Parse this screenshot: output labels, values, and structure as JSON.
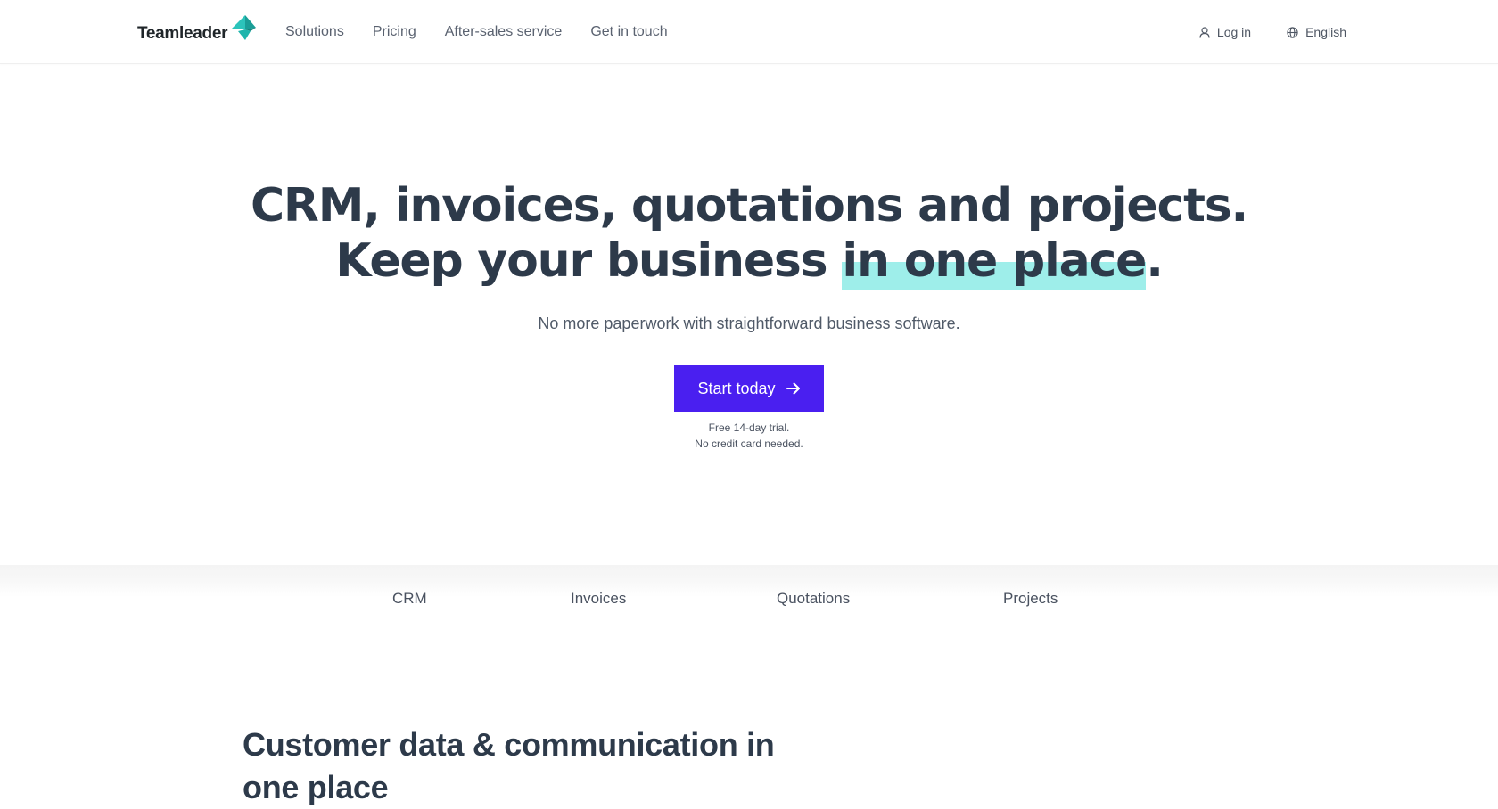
{
  "header": {
    "logo_text": "Teamleader",
    "nav": [
      {
        "label": "Solutions"
      },
      {
        "label": "Pricing"
      },
      {
        "label": "After-sales service"
      },
      {
        "label": "Get in touch"
      }
    ],
    "login": {
      "label": "Log in",
      "icon": "user-icon"
    },
    "language": {
      "label": "English",
      "icon": "globe-icon"
    }
  },
  "hero": {
    "title_line1": "CRM, invoices, quotations and projects.",
    "title_line2_prefix": "Keep your business ",
    "title_line2_highlight": "in one place",
    "title_line2_suffix": ".",
    "subtitle": "No more paperwork with straightforward business software.",
    "cta": {
      "label": "Start today",
      "icon": "arrow-right-icon"
    },
    "note_line1": "Free 14-day trial.",
    "note_line2": "No credit card needed."
  },
  "feature_tabs": [
    {
      "label": "CRM"
    },
    {
      "label": "Invoices"
    },
    {
      "label": "Quotations"
    },
    {
      "label": "Projects"
    }
  ],
  "section": {
    "title": "Customer data & communication in one place"
  },
  "colors": {
    "primary": "#4a1ff0",
    "highlight": "#9eeeea",
    "logo_accent": "#1fb5ad",
    "text_dark": "#2d3a4a",
    "text_muted": "#5a6270"
  }
}
